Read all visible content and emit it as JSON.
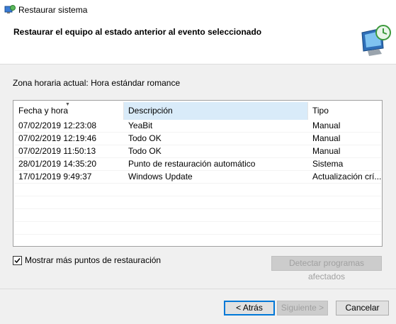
{
  "window": {
    "title": "Restaurar sistema"
  },
  "header": {
    "heading": "Restaurar el equipo al estado anterior al evento seleccionado"
  },
  "timezone": {
    "text": "Zona horaria actual: Hora estándar romance"
  },
  "table": {
    "columns": [
      "Fecha y hora",
      "Descripción",
      "Tipo"
    ],
    "sorted_column": "Descripción",
    "rows": [
      {
        "date": "07/02/2019 12:23:08",
        "desc": "YeaBit",
        "type": "Manual"
      },
      {
        "date": "07/02/2019 12:19:46",
        "desc": "Todo OK",
        "type": "Manual"
      },
      {
        "date": "07/02/2019 11:50:13",
        "desc": "Todo OK",
        "type": "Manual"
      },
      {
        "date": "28/01/2019 14:35:20",
        "desc": "Punto de restauración automático",
        "type": "Sistema"
      },
      {
        "date": "17/01/2019 9:49:37",
        "desc": "Windows Update",
        "type": "Actualización crí..."
      }
    ]
  },
  "checkbox": {
    "label": "Mostrar más puntos de restauración",
    "checked": true
  },
  "buttons": {
    "detect": "Detectar programas afectados",
    "back": "< Atrás",
    "next": "Siguiente >",
    "cancel": "Cancelar"
  },
  "colors": {
    "accent": "#0078d7",
    "sorted_header": "#d9ebf9"
  },
  "icons": {
    "app": "system-restore-icon",
    "header": "monitor-restore-icon",
    "check": "check-icon"
  }
}
